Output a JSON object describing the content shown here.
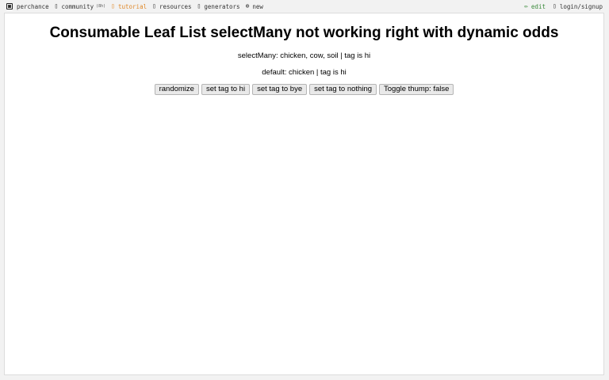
{
  "nav": {
    "brand": "perchance",
    "community": "community",
    "community_badge": "(8h)",
    "tutorial": "tutorial",
    "resources": "resources",
    "generators": "generators",
    "new": "new",
    "edit": "edit",
    "login": "login/signup",
    "tutorial_color": "#e08a2c",
    "edit_color": "#3a8a3a"
  },
  "main": {
    "title": "Consumable Leaf List selectMany not working right with dynamic odds",
    "line1": "selectMany: chicken, cow, soil | tag is hi",
    "line2": "default: chicken | tag is hi",
    "buttons": {
      "randomize": "randomize",
      "set_hi": "set tag to hi",
      "set_bye": "set tag to bye",
      "set_nothing": "set tag to nothing",
      "toggle_thump": "Toggle thump: false"
    }
  }
}
